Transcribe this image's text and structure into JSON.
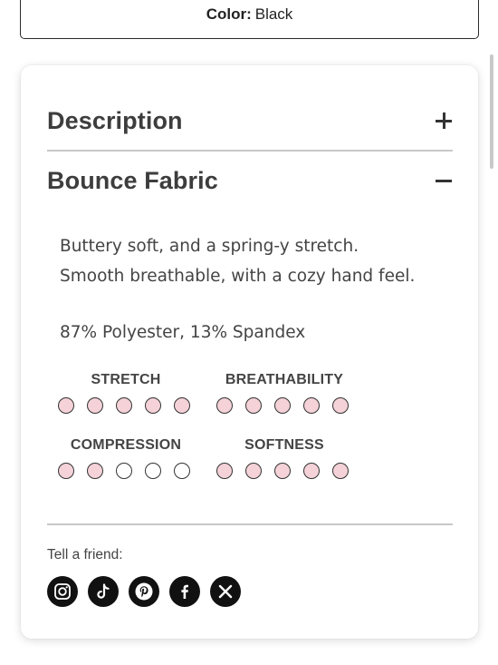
{
  "variant": {
    "label": "Color:",
    "value": "Black"
  },
  "accordion": {
    "description": {
      "title": "Description",
      "state": "collapsed"
    },
    "fabric": {
      "title": "Bounce Fabric",
      "state": "expanded",
      "line1": "Buttery soft, and a spring-y stretch.",
      "line2": "Smooth breathable, with a cozy hand feel.",
      "composition": "87% Polyester, 13% Spandex"
    }
  },
  "metrics": [
    {
      "label": "STRETCH",
      "filled": 5,
      "total": 5
    },
    {
      "label": "BREATHABILITY",
      "filled": 5,
      "total": 5
    },
    {
      "label": "COMPRESSION",
      "filled": 2,
      "total": 5
    },
    {
      "label": "SOFTNESS",
      "filled": 5,
      "total": 5
    }
  ],
  "share": {
    "label": "Tell a friend:",
    "icons": [
      "instagram-icon",
      "tiktok-icon",
      "pinterest-icon",
      "facebook-icon",
      "x-icon"
    ]
  },
  "colors": {
    "dot_fill": "#f4d2d8",
    "text": "#3c3c3c",
    "icon_bg": "#111111"
  }
}
